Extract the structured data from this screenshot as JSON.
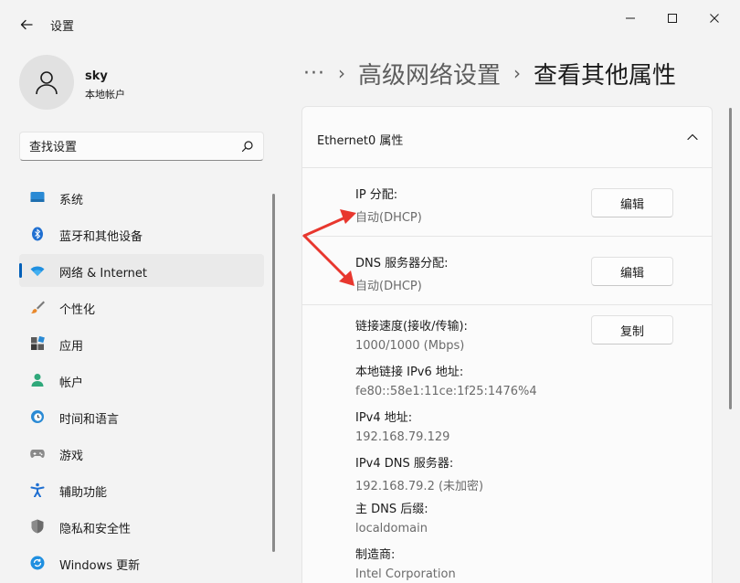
{
  "window": {
    "title": "设置"
  },
  "profile": {
    "name": "sky",
    "account_type": "本地帐户"
  },
  "search": {
    "placeholder": "查找设置"
  },
  "sidebar": {
    "active_index": 2,
    "accent_color": "#005fb8",
    "items": [
      {
        "label": "系统",
        "icon": "monitor-icon"
      },
      {
        "label": "蓝牙和其他设备",
        "icon": "bluetooth-icon"
      },
      {
        "label": "网络 & Internet",
        "icon": "wifi-icon"
      },
      {
        "label": "个性化",
        "icon": "brush-icon"
      },
      {
        "label": "应用",
        "icon": "apps-icon"
      },
      {
        "label": "帐户",
        "icon": "person-icon"
      },
      {
        "label": "时间和语言",
        "icon": "clock-globe-icon"
      },
      {
        "label": "游戏",
        "icon": "gamepad-icon"
      },
      {
        "label": "辅助功能",
        "icon": "accessibility-icon"
      },
      {
        "label": "隐私和安全性",
        "icon": "shield-icon"
      },
      {
        "label": "Windows 更新",
        "icon": "update-icon"
      }
    ]
  },
  "breadcrumb": {
    "more": "···",
    "parent": "高级网络设置",
    "current": "查看其他属性"
  },
  "panel": {
    "title": "Ethernet0 属性",
    "ip_assignment": {
      "label": "IP 分配:",
      "value": "自动(DHCP)",
      "button": "编辑"
    },
    "dns_assignment": {
      "label": "DNS 服务器分配:",
      "value": "自动(DHCP)",
      "button": "编辑"
    },
    "copy_button": "复制",
    "details": [
      {
        "label": "链接速度(接收/传输):",
        "value": "1000/1000 (Mbps)"
      },
      {
        "label": "本地链接 IPv6 地址:",
        "value": "fe80::58e1:11ce:1f25:1476%4"
      },
      {
        "label": "IPv4 地址:",
        "value": "192.168.79.129"
      },
      {
        "label": "IPv4 DNS 服务器:",
        "value": "192.168.79.2 (未加密)"
      },
      {
        "label": "主 DNS 后缀:",
        "value": "localdomain"
      },
      {
        "label": "制造商:",
        "value": "Intel Corporation"
      }
    ]
  },
  "annotation": {
    "arrow_color": "#e8372e"
  }
}
